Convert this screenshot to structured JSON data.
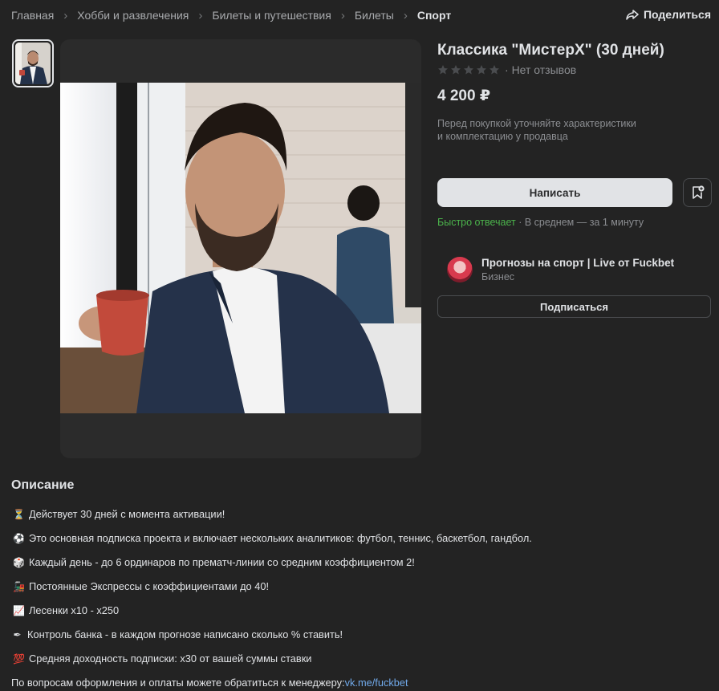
{
  "breadcrumbs": [
    {
      "label": "Главная"
    },
    {
      "label": "Хобби и развлечения"
    },
    {
      "label": "Билеты и путешествия"
    },
    {
      "label": "Билеты"
    },
    {
      "label": "Спорт"
    }
  ],
  "share_label": "Поделиться",
  "product": {
    "title": "Классика \"МистерХ\" (30 дней)",
    "reviews_text": "Нет отзывов",
    "rating_stars": 0,
    "price": "4 200 ₽",
    "note_line1": "Перед покупкой уточняйте характеристики",
    "note_line2": "и комплектацию у продавца"
  },
  "actions": {
    "write_label": "Написать",
    "bookmark_icon": "bookmark-add-icon"
  },
  "response": {
    "fast": "Быстро отвечает",
    "avg": " · В среднем — за 1 минуту"
  },
  "seller": {
    "name": "Прогнозы на спорт | Live от Fuckbet",
    "type": "Бизнес",
    "subscribe_label": "Подписаться"
  },
  "description": {
    "heading": "Описание",
    "lines": [
      {
        "emoji": "⏳",
        "text": "Действует 30 дней с момента активации!"
      },
      {
        "emoji": "⚽",
        "text": "Это основная подписка проекта и включает нескольких аналитиков: футбол, теннис, баскетбол, гандбол."
      },
      {
        "emoji": "🎲",
        "text": "Каждый день - до 6 ординаров по прематч-линии со средним коэффициентом 2!"
      },
      {
        "emoji": "🚂",
        "text": "Постоянные Экспрессы с коэффициентами до 40!"
      },
      {
        "emoji": "📈",
        "text": "Лесенки x10 - x250"
      },
      {
        "emoji": "✒",
        "text": "Контроль банка - в каждом прогнозе написано сколько % ставить!"
      },
      {
        "emoji": "💯",
        "text": "Средняя доходность подписки: x30 от вашей суммы ставки"
      }
    ],
    "contact_text": "По вопросам оформления и оплаты можете обратиться к менеджеру: ",
    "contact_link": "vk.me/fuckbet"
  },
  "colors": {
    "background": "#232323",
    "accent_green": "#4bb34b",
    "link_blue": "#71aaeb"
  }
}
